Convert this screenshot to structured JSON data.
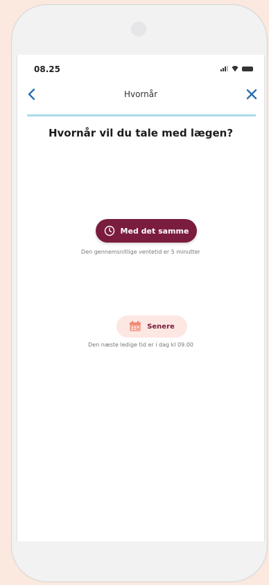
{
  "status_bar": {
    "time": "08.25"
  },
  "nav": {
    "title": "Hvornår"
  },
  "heading": "Hvornår vil du tale med lægen?",
  "options": {
    "now": {
      "label": "Med det samme",
      "subtitle": "Den gennemsnitlige ventetid er 5 minutter"
    },
    "later": {
      "label": "Senere",
      "subtitle": "Den næste ledige tid er i dag kl 09.00"
    }
  },
  "colors": {
    "accent": "#7a1c3e",
    "secondary_bg": "#fde7e2",
    "divider": "#a8dbe8",
    "nav_icon": "#2a6fb0",
    "page_bg": "#fbe8de"
  },
  "icons": {
    "back": "chevron-left-icon",
    "close": "close-icon",
    "now": "clock-icon",
    "later": "calendar-icon"
  }
}
